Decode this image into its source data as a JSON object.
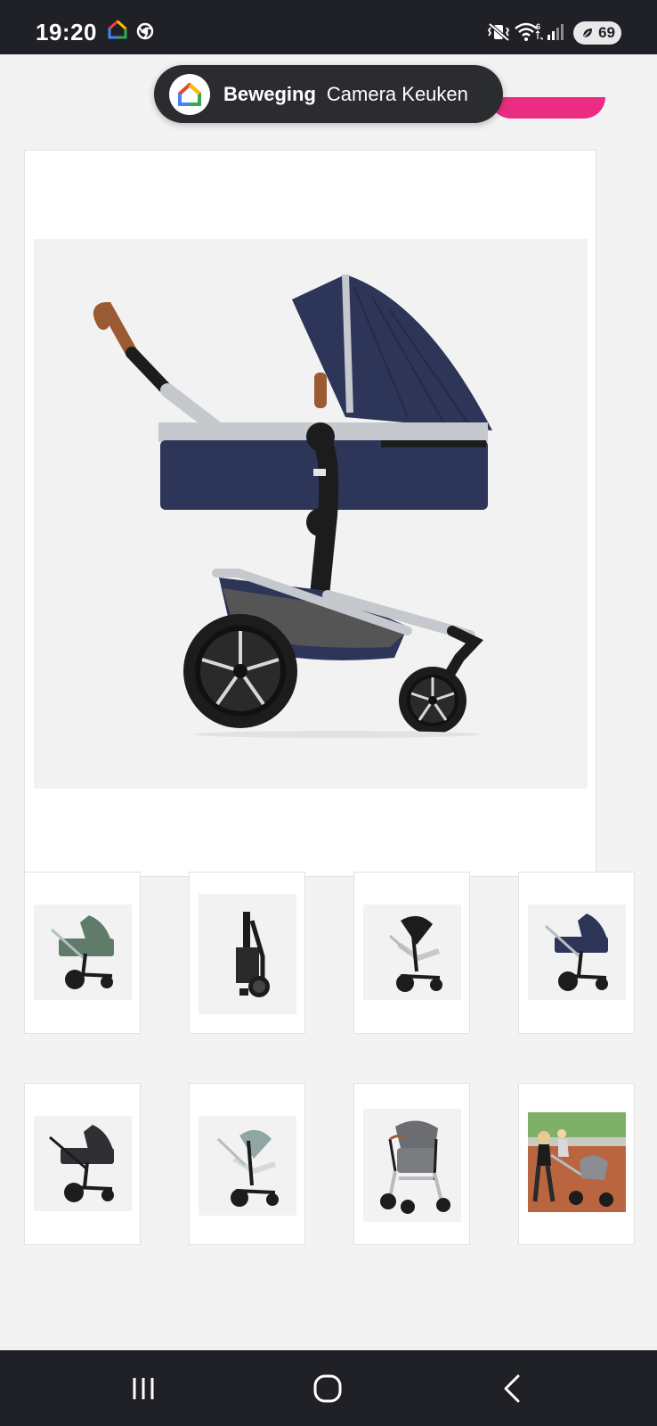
{
  "status_bar": {
    "time": "19:20",
    "battery_level": "69",
    "icons": [
      "google-home-icon",
      "chrome-icon",
      "mute-vibrate-icon",
      "wifi-icon",
      "signal-icon",
      "battery-icon"
    ]
  },
  "notification": {
    "app_icon": "google-home-icon",
    "title": "Beweging",
    "text": "Camera Keuken"
  },
  "product_gallery": {
    "main_image": "stroller-navy-carrycot-side-view",
    "thumbnails": [
      {
        "image": "stroller-green-carrycot"
      },
      {
        "image": "stroller-folded"
      },
      {
        "image": "stroller-black-seat"
      },
      {
        "image": "stroller-navy-carrycot"
      },
      {
        "image": "stroller-black-carrycot"
      },
      {
        "image": "stroller-mint-seat"
      },
      {
        "image": "stroller-grey-seat-angled"
      },
      {
        "image": "lifestyle-photo-woman-with-stroller"
      }
    ]
  },
  "navigation_bar": {
    "buttons": [
      "recent-apps-icon",
      "home-icon",
      "back-icon"
    ]
  },
  "colors": {
    "status_bar_bg": "#202127",
    "accent_pink": "#ea2d83",
    "stroller_navy": "#2d3558",
    "frame_silver": "#b8bcc2"
  }
}
